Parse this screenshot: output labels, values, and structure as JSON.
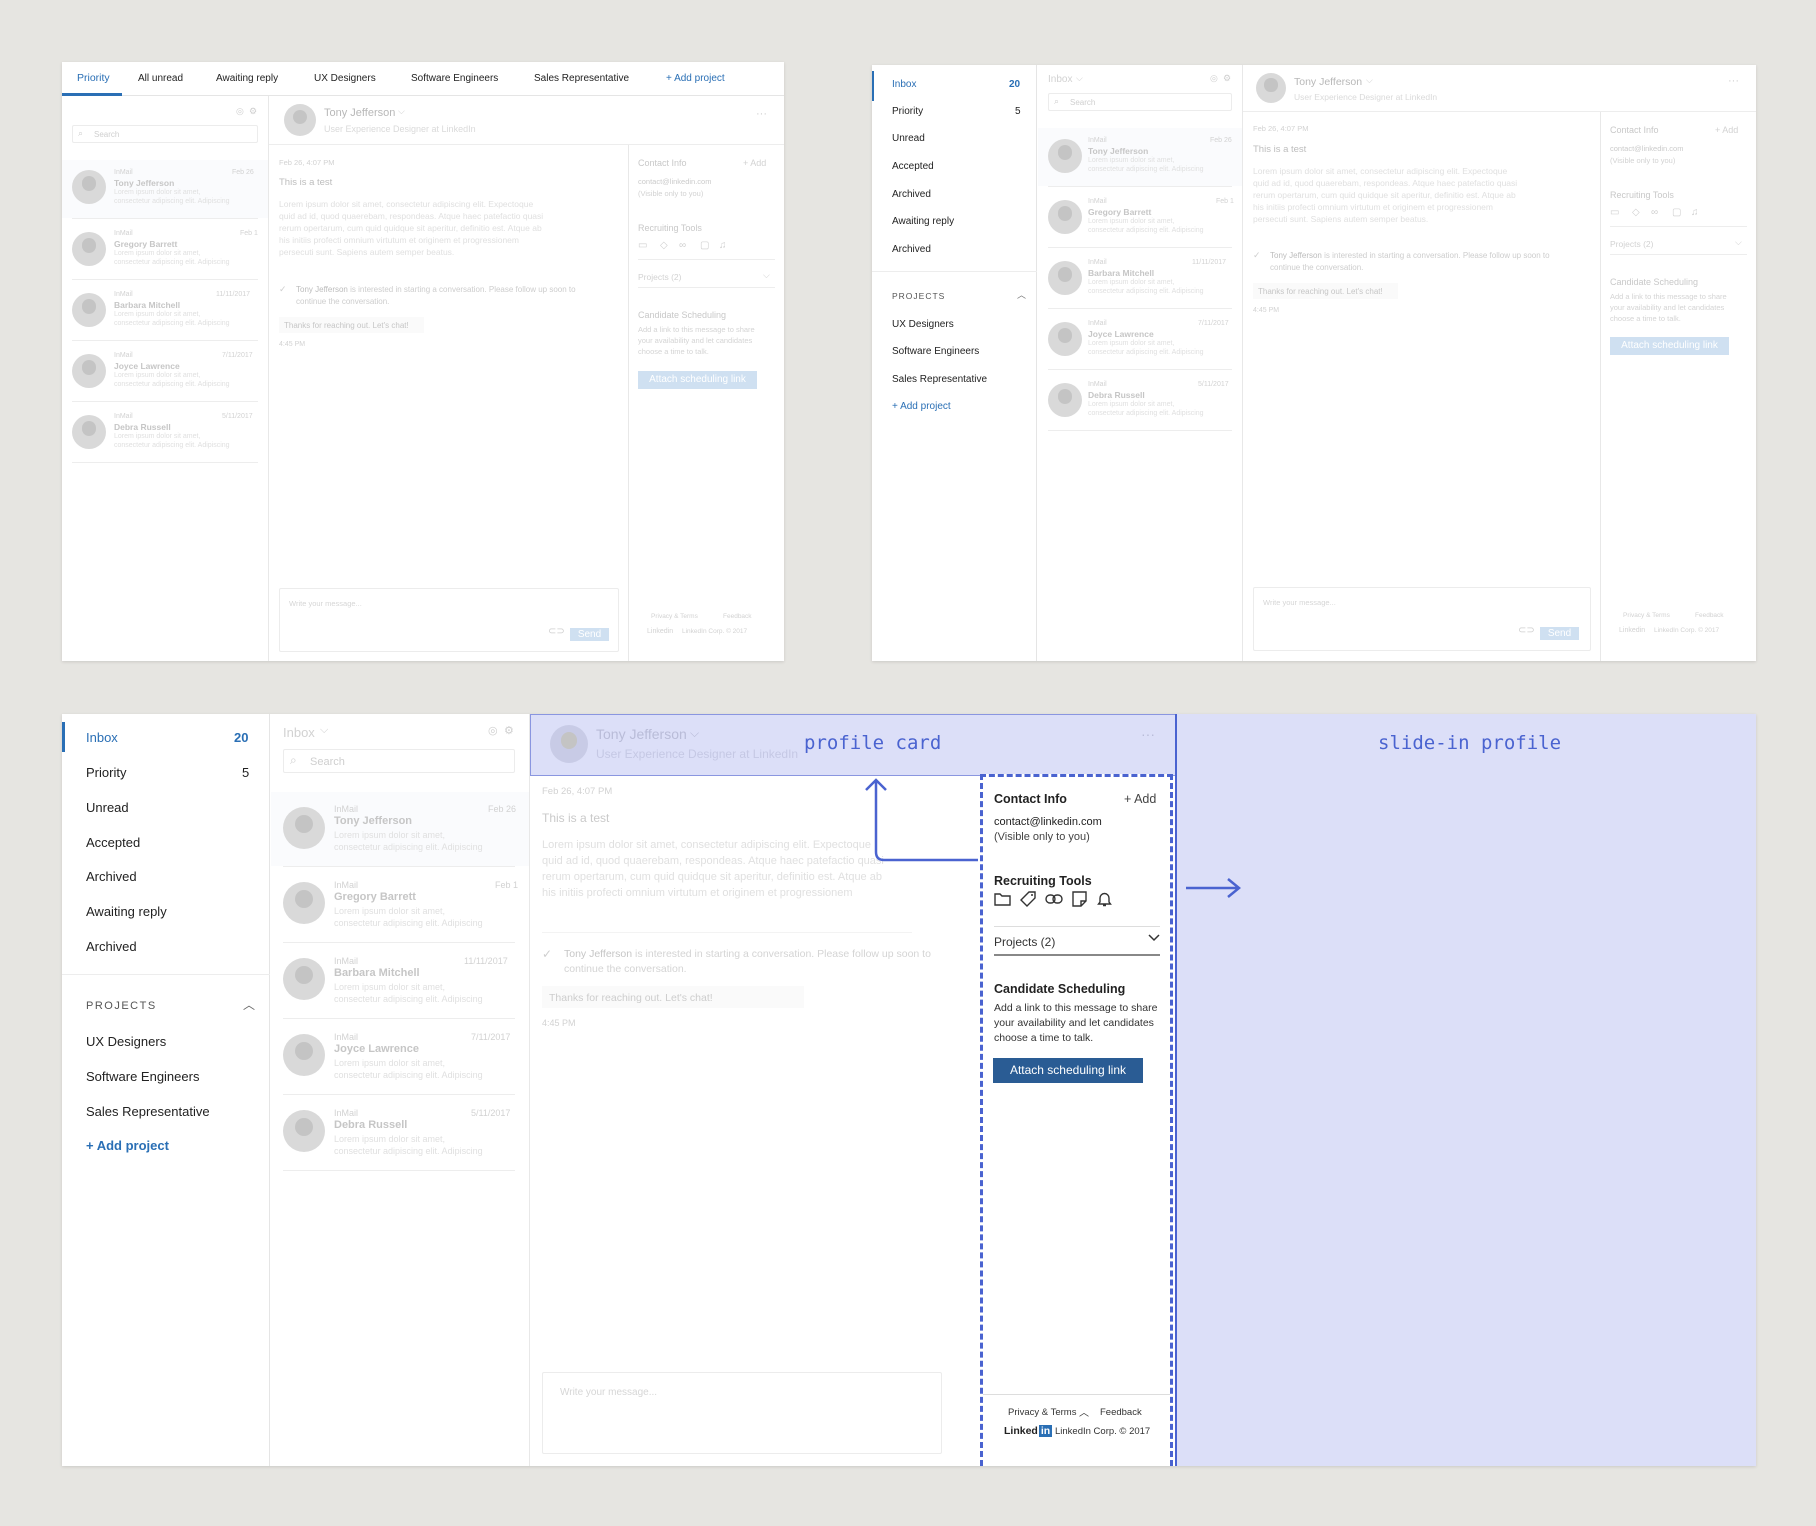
{
  "tabs": [
    "Priority",
    "All unread",
    "Awaiting reply",
    "UX Designers",
    "Software Engineers",
    "Sales Representative",
    "+ Add project"
  ],
  "search_placeholder": "Search",
  "inbox_label": "Inbox",
  "sidebar": {
    "items": [
      {
        "label": "Inbox",
        "count": "20"
      },
      {
        "label": "Priority",
        "count": "5"
      },
      {
        "label": "Unread",
        "count": ""
      },
      {
        "label": "Accepted",
        "count": ""
      },
      {
        "label": "Archived",
        "count": ""
      },
      {
        "label": "Awaiting reply",
        "count": ""
      },
      {
        "label": "Archived",
        "count": ""
      }
    ],
    "projects_heading": "PROJECTS",
    "projects": [
      "UX Designers",
      "Software Engineers",
      "Sales Representative"
    ],
    "add_project": "+ Add project"
  },
  "conversations": [
    {
      "tag": "InMail",
      "name": "Tony Jefferson",
      "date": "Feb 26",
      "preview1": "Lorem ipsum dolor sit amet,",
      "preview2": "consectetur adipiscing elit. Adipiscing"
    },
    {
      "tag": "InMail",
      "name": "Gregory Barrett",
      "date": "Feb 1",
      "preview1": "Lorem ipsum dolor sit amet,",
      "preview2": "consectetur adipiscing elit. Adipiscing"
    },
    {
      "tag": "InMail",
      "name": "Barbara Mitchell",
      "date": "11/11/2017",
      "preview1": "Lorem ipsum dolor sit amet,",
      "preview2": "consectetur adipiscing elit. Adipiscing"
    },
    {
      "tag": "InMail",
      "name": "Joyce Lawrence",
      "date": "7/11/2017",
      "preview1": "Lorem ipsum dolor sit amet,",
      "preview2": "consectetur adipiscing elit. Adipiscing"
    },
    {
      "tag": "InMail",
      "name": "Debra Russell",
      "date": "5/11/2017",
      "preview1": "Lorem ipsum dolor sit amet,",
      "preview2": "consectetur adipiscing elit. Adipiscing"
    }
  ],
  "message": {
    "header_name": "Tony Jefferson",
    "header_title": "User Experience Designer at LinkedIn",
    "timestamp": "Feb 26, 4:07 PM",
    "subject": "This is a test",
    "body1": "Lorem ipsum dolor sit amet, consectetur adipiscing elit. Expectoque",
    "body2": "quid ad id, quod quaerebam, respondeas. Atque haec patefactio quasi",
    "body3": "rerum opertarum, cum quid quidque sit aperitur, definitio est. Atque ab",
    "body4": "his initiis profecti omnium virtutum et originem et progressionem",
    "body5": "persecuti sunt. Sapiens autem semper beatus.",
    "interest_name": "Tony Jefferson",
    "interest_rest": " is interested in starting a conversation. Please follow up soon to",
    "interest_line2": "continue the conversation.",
    "quick_reply": "Thanks for reaching out. Let's chat!",
    "time": "4:45 PM",
    "compose_placeholder": "Write your message...",
    "send": "Send"
  },
  "contact": {
    "title": "Contact Info",
    "add": "+ Add",
    "email": "contact@linkedin.com",
    "visibility": "(Visible only to you)",
    "recruiting_title": "Recruiting Tools",
    "projects_dropdown": "Projects (2)",
    "scheduling_title": "Candidate Scheduling",
    "scheduling_l1": "Add a link to this message to share",
    "scheduling_l2": "your availability and let candidates",
    "scheduling_l3": "choose a time to talk.",
    "attach_button": "Attach scheduling link"
  },
  "footer": {
    "privacy": "Privacy & Terms",
    "feedback": "Feedback",
    "brand": "Linked",
    "brand_in": "in",
    "copyright": "LinkedIn Corp. © 2017"
  },
  "annotations": {
    "profile_card": "profile card",
    "slide_in": "slide-in profile"
  },
  "colors": {
    "accent": "#2a6fb5",
    "highlight": "#dcdff8",
    "annotation": "#4a63d0"
  }
}
